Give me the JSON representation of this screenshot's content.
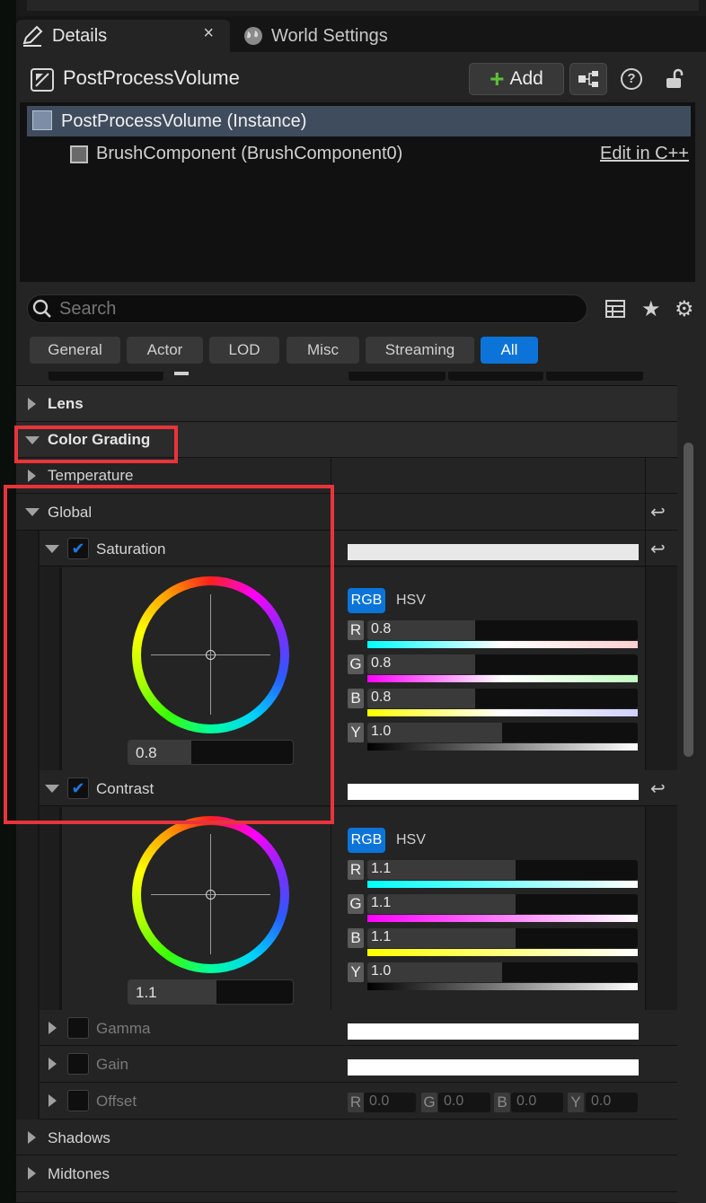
{
  "tabs": [
    {
      "label": "Details",
      "close": "×"
    },
    {
      "label": "World Settings"
    }
  ],
  "actor": {
    "name": "PostProcessVolume",
    "add_label": "Add"
  },
  "tree": {
    "root": "PostProcessVolume (Instance)",
    "child": "BrushComponent (BrushComponent0)",
    "edit_link": "Edit in C++"
  },
  "search": {
    "placeholder": "Search"
  },
  "filters": [
    "General",
    "Actor",
    "LOD",
    "Misc",
    "Streaming",
    "All"
  ],
  "active_filter": "All",
  "sections": {
    "lens": "Lens",
    "color_grading": "Color Grading",
    "temperature": "Temperature",
    "global": "Global",
    "saturation": "Saturation",
    "contrast": "Contrast",
    "gamma": "Gamma",
    "gain": "Gain",
    "offset": "Offset",
    "shadows": "Shadows",
    "midtones": "Midtones"
  },
  "saturation": {
    "enabled": true,
    "wheel_value": "0.8",
    "mode_rgb": "RGB",
    "mode_hsv": "HSV",
    "channels": [
      {
        "tag": "R",
        "value": "0.8"
      },
      {
        "tag": "G",
        "value": "0.8"
      },
      {
        "tag": "B",
        "value": "0.8"
      },
      {
        "tag": "Y",
        "value": "1.0"
      }
    ]
  },
  "contrast": {
    "enabled": true,
    "wheel_value": "1.1",
    "mode_rgb": "RGB",
    "mode_hsv": "HSV",
    "channels": [
      {
        "tag": "R",
        "value": "1.1"
      },
      {
        "tag": "G",
        "value": "1.1"
      },
      {
        "tag": "B",
        "value": "1.1"
      },
      {
        "tag": "Y",
        "value": "1.0"
      }
    ]
  },
  "offset": {
    "channels": [
      {
        "tag": "R",
        "value": "0.0"
      },
      {
        "tag": "G",
        "value": "0.0"
      },
      {
        "tag": "B",
        "value": "0.0"
      },
      {
        "tag": "Y",
        "value": "0.0"
      }
    ]
  },
  "colors": {
    "accent": "#0c74d8",
    "highlight": "#e8343a",
    "selected_row": "#3f4c5d"
  }
}
